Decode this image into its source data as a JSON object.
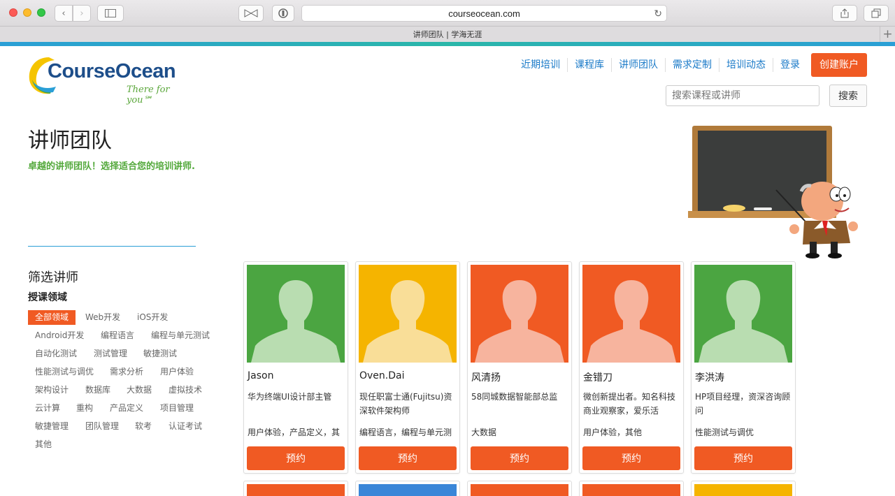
{
  "browser": {
    "url": "courseocean.com",
    "tab_title": "讲师团队 | 学海无涯"
  },
  "header": {
    "logo_text": "CourseOcean",
    "logo_tagline": "There for you℠",
    "nav": [
      "近期培训",
      "课程库",
      "讲师团队",
      "需求定制",
      "培训动态",
      "登录"
    ],
    "create_account": "创建账户",
    "search_placeholder": "搜索课程或讲师",
    "search_button": "搜索"
  },
  "page": {
    "title": "讲师团队",
    "subtitle": "卓越的讲师团队！选择适合您的培训讲师."
  },
  "filter": {
    "title": "筛选讲师",
    "subtitle": "授课领域",
    "tags": [
      "全部领域",
      "Web开发",
      "iOS开发",
      "Android开发",
      "编程语言",
      "编程与单元测试",
      "自动化测试",
      "测试管理",
      "敏捷测试",
      "性能测试与调优",
      "需求分析",
      "用户体验",
      "架构设计",
      "数据库",
      "大数据",
      "虚拟技术",
      "云计算",
      "重构",
      "产品定义",
      "项目管理",
      "敏捷管理",
      "团队管理",
      "软考",
      "认证考试",
      "其他"
    ],
    "active_tag": "全部领域"
  },
  "teachers": [
    {
      "name": "Jason",
      "title": "华为终端UI设计部主管",
      "tags": "用户体验，产品定义，其",
      "button": "预约",
      "bg": "#4ba541",
      "fg": "#b9ddb1"
    },
    {
      "name": "Oven.Dai",
      "title": "现任职富士通(Fujitsu)资深软件架构师",
      "tags": "编程语言，编程与单元测",
      "button": "预约",
      "bg": "#f5b400",
      "fg": "#f9de98"
    },
    {
      "name": "风清扬",
      "title": "58同城数据智能部总监",
      "tags": "大数据",
      "button": "预约",
      "bg": "#f05a23",
      "fg": "#f7b49e"
    },
    {
      "name": "金错刀",
      "title": "微创新提出者。知名科技商业观察家，爱乐活",
      "tags": "用户体验，其他",
      "button": "预约",
      "bg": "#f05a23",
      "fg": "#f7b49e"
    },
    {
      "name": "李洪涛",
      "title": "HP项目经理，资深咨询顾问",
      "tags": "性能测试与调优",
      "button": "预约",
      "bg": "#4ba541",
      "fg": "#b9ddb1"
    }
  ],
  "next_row_colors": [
    "#f05a23",
    "#3a86d8",
    "#f05a23",
    "#f05a23",
    "#f5b400"
  ]
}
